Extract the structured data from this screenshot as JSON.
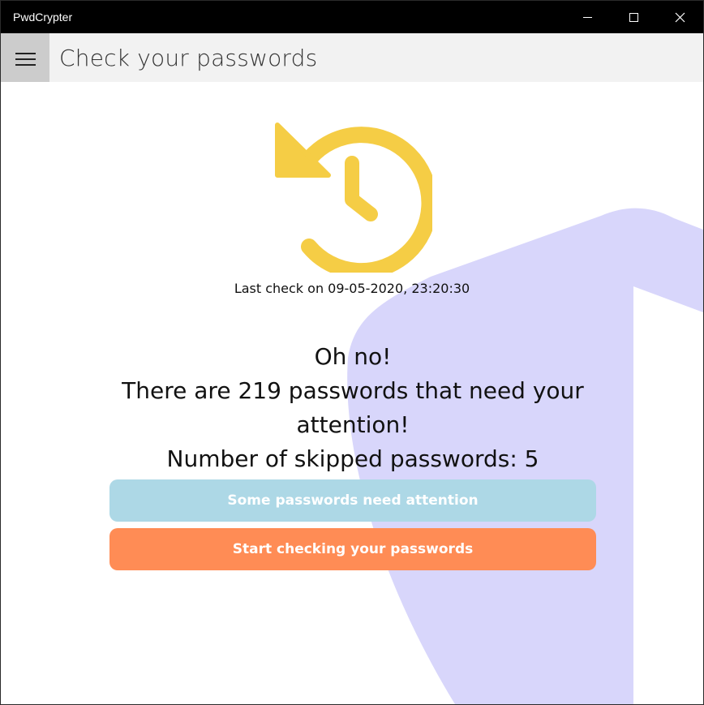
{
  "window": {
    "title": "PwdCrypter"
  },
  "header": {
    "title": "Check your passwords"
  },
  "status": {
    "last_check": "Last check on 09-05-2020, 23:20:30",
    "headline": "Oh no!",
    "message": "There are 219 passwords that need your attention!",
    "skipped": "Number of skipped passwords: 5"
  },
  "buttons": {
    "status_label": "Some passwords need attention",
    "start_label": "Start checking your passwords"
  },
  "colors": {
    "titlebar": "#000000",
    "header": "#f2f2f2",
    "icon": "#f5cd45",
    "decor": "#d8d6fb",
    "status_button": "#add8e6",
    "start_button": "#ff8c55"
  },
  "icons": {
    "hero": "history-clock-icon",
    "menu": "hamburger-menu-icon"
  }
}
